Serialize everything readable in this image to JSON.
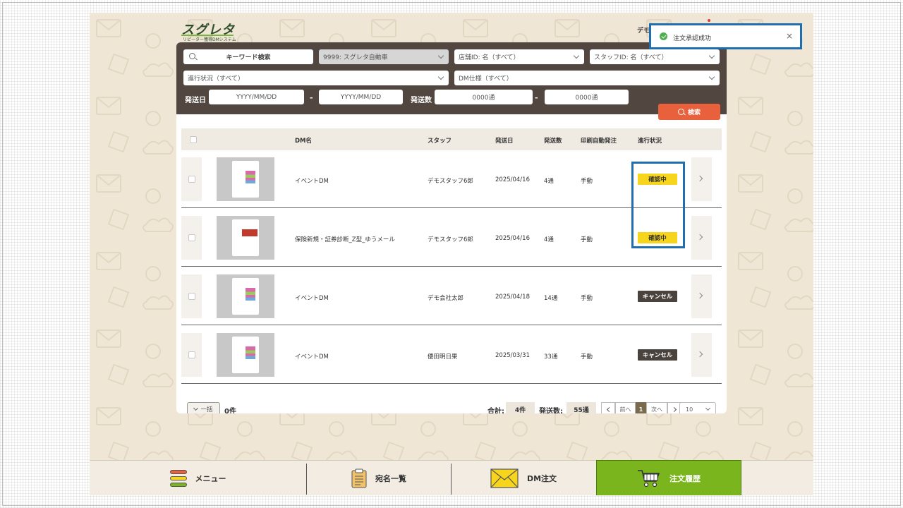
{
  "brand": {
    "logo_main": "スグレタ",
    "logo_sub": "リピーター獲得DMシステム"
  },
  "header": {
    "user_fragment": "デモ"
  },
  "toast": {
    "message": "注文承認成功",
    "close": "×"
  },
  "filters": {
    "keyword_label": "キーワード検索",
    "company": "9999: スグレタ自動車",
    "store": "店舗ID: 名（すべて）",
    "staff": "スタッフID: 名（すべて）",
    "progress": "進行状況（すべて）",
    "dm_spec": "DM仕様（すべて）",
    "send_date_label": "発送日",
    "date_from_placeholder": "YYYY/MM/DD",
    "date_to_placeholder": "YYYY/MM/DD",
    "send_count_label": "発送数",
    "count_from_placeholder": "0000通",
    "count_to_placeholder": "0000通",
    "range_dash": "-",
    "search_button": "検索"
  },
  "table": {
    "headers": {
      "dm_name": "DM名",
      "staff": "スタッフ",
      "send_date": "発送日",
      "send_count": "発送数",
      "auto_print": "印刷自動発注",
      "status": "進行状況"
    },
    "rows": [
      {
        "dm_name": "イベントDM",
        "staff": "デモスタッフ6郎",
        "send_date": "2025/04/16",
        "count": "4通",
        "auto": "手動",
        "status": "確認中",
        "status_type": "confirm",
        "thumb": "pink"
      },
      {
        "dm_name": "保険新規・証券診断_Z型_ゆうメール",
        "staff": "デモスタッフ6郎",
        "send_date": "2025/04/16",
        "count": "4通",
        "auto": "手動",
        "status": "確認中",
        "status_type": "confirm",
        "thumb": "red"
      },
      {
        "dm_name": "イベントDM",
        "staff": "デモ会社太郎",
        "send_date": "2025/04/18",
        "count": "14通",
        "auto": "手動",
        "status": "キャンセル",
        "status_type": "cancel",
        "thumb": "pink"
      },
      {
        "dm_name": "イベントDM",
        "staff": "優田明日果",
        "send_date": "2025/03/31",
        "count": "33通",
        "auto": "手動",
        "status": "キャンセル",
        "status_type": "cancel",
        "thumb": "pink"
      }
    ]
  },
  "footer": {
    "bulk_label": "一括",
    "selected_count": "0件",
    "total_label": "合計:",
    "total_value": "4件",
    "send_total_label": "発送数:",
    "send_total_value": "55通",
    "prev": "前へ",
    "current_page": "1",
    "next": "次へ",
    "per_page": "10"
  },
  "nav": {
    "menu": "メニュー",
    "address_list": "宛名一覧",
    "dm_order": "DM注文",
    "order_history": "注文履歴"
  },
  "colors": {
    "accent_green": "#7ab51d",
    "search_orange": "#e8603c",
    "confirm_yellow": "#f7d51d",
    "highlight_blue": "#1f6fb0",
    "filter_bg": "#514740"
  }
}
